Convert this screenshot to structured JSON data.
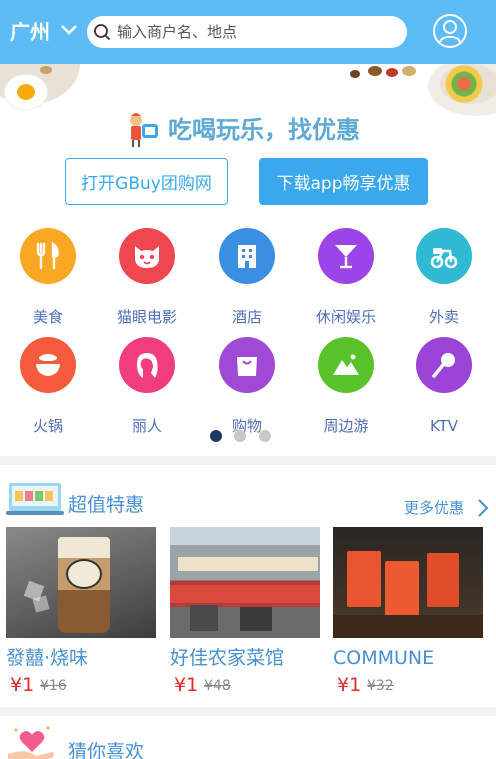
{
  "header": {
    "city": "广州",
    "search_placeholder": "输入商户名、地点"
  },
  "banner": {
    "title": "吃喝玩乐，找优惠",
    "open_button": "打开GBuy团购网",
    "download_button": "下载app畅享优惠"
  },
  "categories": [
    {
      "label": "美食",
      "icon": "fork-knife-icon",
      "color": "#f9a825"
    },
    {
      "label": "猫眼电影",
      "icon": "cat-icon",
      "color": "#f0464f"
    },
    {
      "label": "酒店",
      "icon": "hotel-icon",
      "color": "#3b8fe0"
    },
    {
      "label": "休闲娱乐",
      "icon": "cocktail-icon",
      "color": "#9b44e8"
    },
    {
      "label": "外卖",
      "icon": "scooter-icon",
      "color": "#2fb9d2"
    },
    {
      "label": "火锅",
      "icon": "hotpot-icon",
      "color": "#f45a3c"
    },
    {
      "label": "丽人",
      "icon": "woman-icon",
      "color": "#f03d7e"
    },
    {
      "label": "购物",
      "icon": "shopping-bag-icon",
      "color": "#9f49d6"
    },
    {
      "label": "周边游",
      "icon": "mountain-icon",
      "color": "#58c22a"
    },
    {
      "label": "KTV",
      "icon": "microphone-icon",
      "color": "#9b44d8"
    }
  ],
  "carousel": {
    "active_index": 0,
    "count": 3
  },
  "deals": {
    "title": "超值特惠",
    "more": "更多优惠",
    "items": [
      {
        "name": "發囍·烧味",
        "price": "¥1",
        "original": "¥16"
      },
      {
        "name": "好佳农家菜馆",
        "price": "¥1",
        "original": "¥48"
      },
      {
        "name": "COMMUNE",
        "price": "¥1",
        "original": "¥32"
      }
    ]
  },
  "guess": {
    "title": "猜你喜欢"
  },
  "colors": {
    "header": "#5dbbf5",
    "accent": "#3aa8ee",
    "link": "#4891d3",
    "price": "#e8262b"
  }
}
